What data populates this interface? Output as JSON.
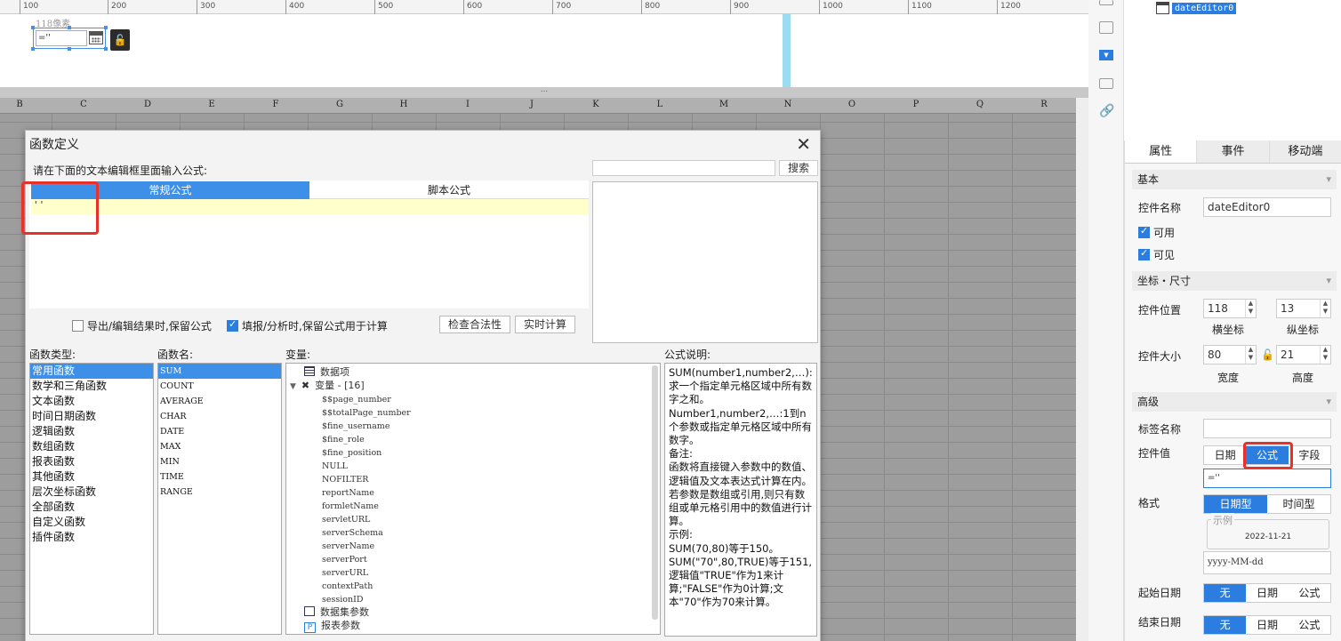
{
  "ruler": {
    "ticks": [
      "100",
      "200",
      "300",
      "400",
      "500",
      "600",
      "700",
      "800",
      "900",
      "1000",
      "1100",
      "1200"
    ]
  },
  "canvas": {
    "pixel_label": "118像素",
    "widget_value": "=''"
  },
  "sheet": {
    "columns": [
      "B",
      "C",
      "D",
      "E",
      "F",
      "G",
      "H",
      "I",
      "J",
      "K",
      "L",
      "M",
      "N",
      "O",
      "P",
      "Q",
      "R"
    ]
  },
  "dialog": {
    "title": "函数定义",
    "close": "✕",
    "instruction": "请在下面的文本编辑框里面输入公式:",
    "search_label": "搜索",
    "tab_normal": "常规公式",
    "tab_script": "脚本公式",
    "formula": "''",
    "opt_export": "导出/编辑结果时,保留公式",
    "opt_fill": "填报/分析时,保留公式用于计算",
    "btn_check": "检查合法性",
    "btn_realtime": "实时计算",
    "label_types": "函数类型:",
    "label_names": "函数名:",
    "label_vars": "变量:",
    "label_desc": "公式说明:",
    "function_types": [
      "常用函数",
      "数学和三角函数",
      "文本函数",
      "时间日期函数",
      "逻辑函数",
      "数组函数",
      "报表函数",
      "其他函数",
      "层次坐标函数",
      "全部函数",
      "自定义函数",
      "插件函数"
    ],
    "function_names": [
      "SUM",
      "COUNT",
      "AVERAGE",
      "CHAR",
      "DATE",
      "MAX",
      "MIN",
      "TIME",
      "RANGE"
    ],
    "vars": {
      "data_items": "数据项",
      "variables": "变量 - [16]",
      "items": [
        "$$page_number",
        "$$totalPage_number",
        "$fine_username",
        "$fine_role",
        "$fine_position",
        "NULL",
        "NOFILTER",
        "reportName",
        "formletName",
        "servletURL",
        "serverSchema",
        "serverName",
        "serverPort",
        "serverURL",
        "contextPath",
        "sessionID"
      ],
      "dataset_params": "数据集参数",
      "report_params": "报表参数"
    },
    "description": {
      "l1": "SUM(number1,number2,…):求一个指定单元格区域中所有数字之和。",
      "l2": "Number1,number2,…:1到n个参数或指定单元格区域中所有数字。",
      "l3": "备注:",
      "l4": "函数将直接键入参数中的数值、逻辑值及文本表达式计算在内。若参数是数组或引用,则只有数组或单元格引用中的数值进行计算。",
      "l5": "示例:",
      "l6": "SUM(70,80)等于150。",
      "l7": "SUM(\"70\",80,TRUE)等于151,逻辑值\"TRUE\"作为1来计算;\"FALSE\"作为0计算;文本\"70\"作为70来计算。"
    }
  },
  "tree": {
    "node": "dateEditor0"
  },
  "props": {
    "tabs": [
      "属性",
      "事件",
      "移动端"
    ],
    "basic": "基本",
    "name_label": "控件名称",
    "name_value": "dateEditor0",
    "enabled": "可用",
    "visible": "可见",
    "coord": "坐标・尺寸",
    "pos_label": "控件位置",
    "pos_x": "118",
    "pos_y": "13",
    "x_label": "横坐标",
    "y_label": "纵坐标",
    "size_label": "控件大小",
    "width": "80",
    "height": "21",
    "w_label": "宽度",
    "h_label": "高度",
    "advanced": "高级",
    "tag_label": "标签名称",
    "value_label": "控件值",
    "value_opts": [
      "日期",
      "公式",
      "字段"
    ],
    "value_formula": "=''",
    "format_label": "格式",
    "format_opts": [
      "日期型",
      "时间型"
    ],
    "example_label": "示例",
    "example_value": "2022-11-21",
    "pattern": "yyyy-MM-dd",
    "start_label": "起始日期",
    "end_label": "结束日期",
    "date_opts": [
      "无",
      "日期",
      "公式"
    ]
  },
  "colors": {
    "accent": "#2b7de0",
    "highlight_box": "#e8312b"
  }
}
